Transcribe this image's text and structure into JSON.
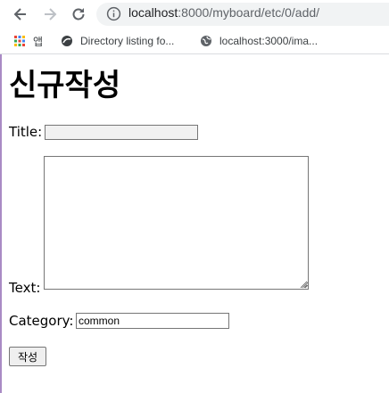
{
  "browser": {
    "url_host": "localhost",
    "url_path": ":8000/myboard/etc/0/add/",
    "bookmarks": [
      {
        "label": "앱",
        "icon": "apps-grid-icon"
      },
      {
        "label": "Directory listing fo...",
        "icon": "site-favicon-icon"
      },
      {
        "label": "localhost:3000/ima...",
        "icon": "globe-icon"
      }
    ]
  },
  "page": {
    "title": "신규작성",
    "title_label": "Title:",
    "title_value": "",
    "text_label": "Text:",
    "text_value": "",
    "category_label": "Category:",
    "category_value": "common",
    "submit_label": "작성"
  }
}
